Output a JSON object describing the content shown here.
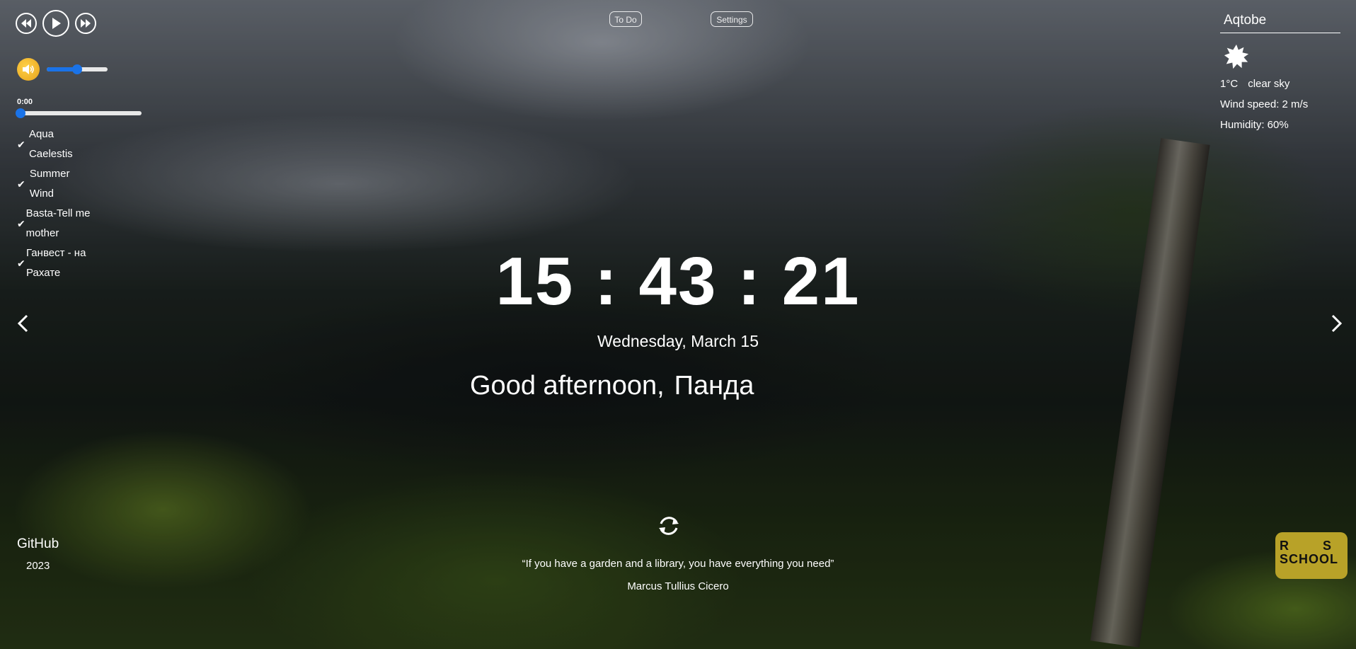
{
  "player": {
    "current_time": "0:00",
    "volume_fraction": 0.5,
    "progress_fraction": 0.0,
    "tracks": [
      {
        "title": "Aqua Caelestis"
      },
      {
        "title": "Summer Wind"
      },
      {
        "title": "Basta-Tell me mother"
      },
      {
        "title": "Ганвест - на Рахате"
      }
    ]
  },
  "nav": {
    "todo_label": "To Do",
    "settings_label": "Settings"
  },
  "weather": {
    "city": "Aqtobe",
    "icon": "sun-icon",
    "temperature": "1°C",
    "description": "clear sky",
    "wind": "Wind speed: 2 m/s",
    "humidity": "Humidity: 60%"
  },
  "clock": {
    "hours": "15",
    "minutes": "43",
    "seconds": "21",
    "separator": ":"
  },
  "date": "Wednesday, March 15",
  "greeting": {
    "text": "Good afternoon,",
    "name": "Панда"
  },
  "quote": {
    "text": "“If you have a garden and a library, you have everything you need”",
    "author": "Marcus Tullius Cicero"
  },
  "footer": {
    "github_label": "GitHub",
    "year": "2023",
    "school_logo_text": "RS SCHOOL"
  },
  "colors": {
    "accent": "#1a73e8",
    "volume_icon": "#f0b429",
    "school_badge": "#b8a228"
  }
}
